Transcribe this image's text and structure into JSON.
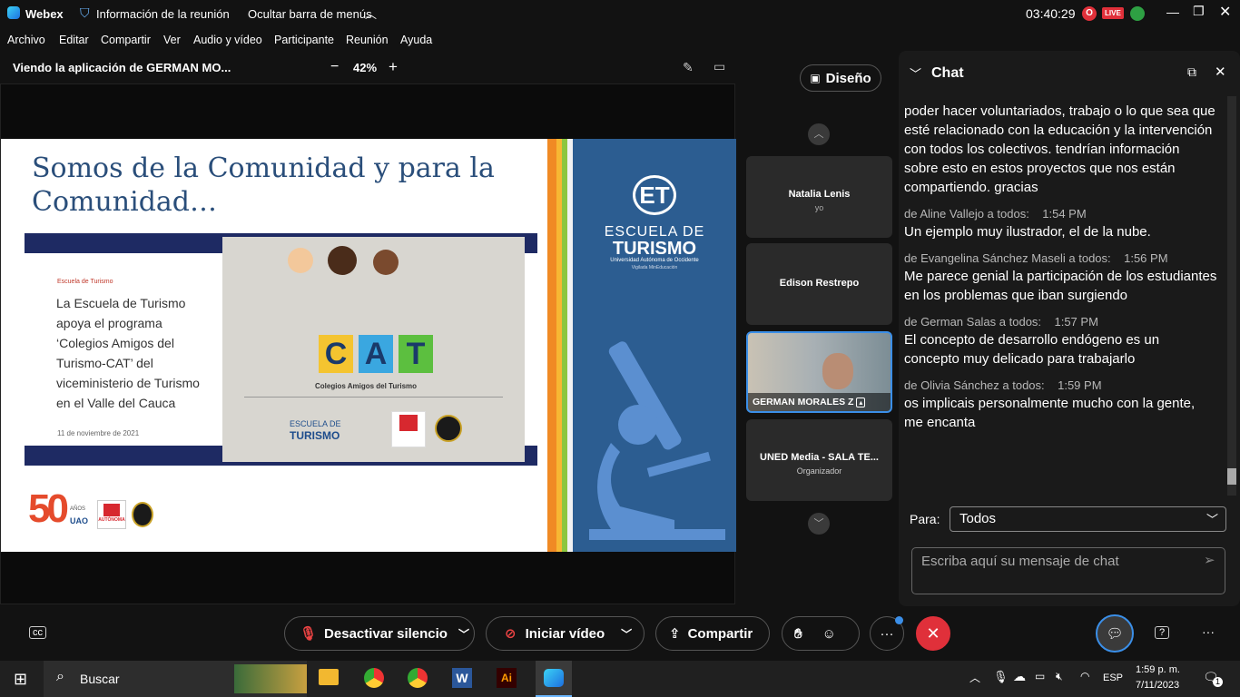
{
  "titlebar": {
    "app": "Webex",
    "meeting_info": "Información de la reunión",
    "hide_menu": "Ocultar barra de menús",
    "timer": "03:40:29",
    "live": "LIVE"
  },
  "menu": [
    "Archivo",
    "Editar",
    "Compartir",
    "Ver",
    "Audio y vídeo",
    "Participante",
    "Reunión",
    "Ayuda"
  ],
  "share": {
    "viewing": "Viendo la aplicación de GERMAN MO...",
    "zoom": "42%",
    "minus": "−",
    "plus": "+"
  },
  "layout_button": "Diseño",
  "slide": {
    "title": "Somos de la Comunidad y para la Comunidad…",
    "inner_tag": "Escuela de Turismo",
    "inner_text": "La Escuela de Turismo apoya el programa ‘Colegios Amigos del Turismo-CAT’ del viceministerio de Turismo en el Valle del Cauca",
    "inner_date": "11 de noviembre de 2021",
    "cat_letters": [
      "C",
      "A",
      "T"
    ],
    "cat_caption": "Colegios Amigos del Turismo",
    "school_line1": "ESCUELA DE",
    "school_line2": "TURISMO",
    "school_sub": "Universidad Autónoma de Occidente",
    "school_sub2": "Vigilada MinEducación",
    "logo_et": "ET",
    "logo_50": "50",
    "logo_anos": "AÑOS",
    "logo_uao": "UAO",
    "logo_autonoma": "AUTÓNOMA",
    "uao_small": "Universidad Autónoma de Occidente",
    "acred": "ACREDITACIÓN INSTITUCIONAL DE ALTA CALIDAD"
  },
  "participants": [
    {
      "name": "Natalia Lenis",
      "sub": "yo"
    },
    {
      "name": "Edison Restrepo",
      "sub": ""
    },
    {
      "name": "GERMAN MORALES Z",
      "sub": ""
    },
    {
      "name": "UNED Media - SALA TE...",
      "sub": "Organizador"
    }
  ],
  "chat": {
    "title": "Chat",
    "first_msg": "poder hacer voluntariados, trabajo o lo que sea que esté relacionado con la educación y la intervención con todos los colectivos. tendrían información sobre esto en estos proyectos que nos están compartiendo. gracias",
    "messages": [
      {
        "meta": "de Aline Vallejo a todos:",
        "time": "1:54 PM",
        "text": "Un ejemplo muy ilustrador, el de la nube."
      },
      {
        "meta": "de Evangelina Sánchez Maseli a todos:",
        "time": "1:56 PM",
        "text": "Me parece genial la participación de los estudiantes en los problemas que iban surgiendo"
      },
      {
        "meta": "de German Salas  a todos:",
        "time": "1:57 PM",
        "text": "El concepto de desarrollo endógeno es un concepto muy delicado para trabajarlo"
      },
      {
        "meta": "de Olivia Sánchez a todos:",
        "time": "1:59 PM",
        "text": "os implicais personalmente mucho con la gente, me encanta"
      }
    ],
    "to_label": "Para:",
    "to_value": "Todos",
    "placeholder": "Escriba aquí su mensaje de chat"
  },
  "controls": {
    "mute": "Desactivar silencio",
    "video": "Iniciar vídeo",
    "share": "Compartir",
    "more": "···",
    "help": "?"
  },
  "taskbar": {
    "search": "Buscar",
    "lang": "ESP",
    "time": "1:59 p. m.",
    "date": "7/11/2023",
    "notif": "1",
    "word": "W",
    "ai": "Ai"
  }
}
